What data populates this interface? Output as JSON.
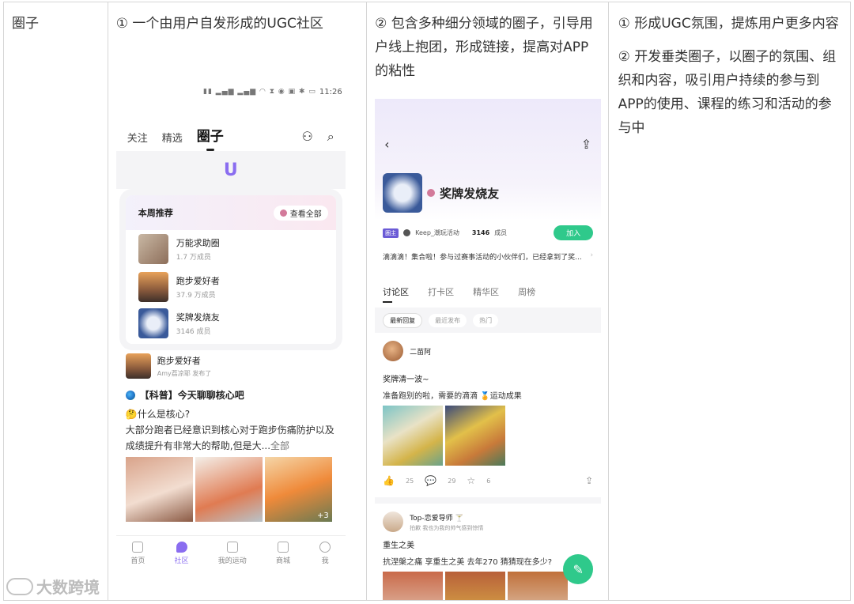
{
  "table": {
    "row_label": "圈子",
    "col2_text": "① 一个由用户自发形成的UGC社区",
    "col3_text": "② 包含多种细分领域的圈子，引导用户线上抱团，形成链接，提高对APP的粘性",
    "col4_p1": "① 形成UGC氛围，提炼用户更多内容",
    "col4_p2": "② 开发垂类圈子，以圈子的氛围、组织和内容，吸引用户持续的参与到APP的使用、课程的练习和活动的参与中"
  },
  "phone1": {
    "status_time": "11:26",
    "tabs": [
      "关注",
      "精选",
      "圈子"
    ],
    "banner_logo": "U",
    "weekly_title": "本周推荐",
    "view_all": "查看全部",
    "circles": [
      {
        "name": "万能求助圈",
        "count": "1.7 万成员"
      },
      {
        "name": "跑步爱好者",
        "count": "37.9 万成员"
      },
      {
        "name": "奖牌发烧友",
        "count": "3146 成员"
      }
    ],
    "post": {
      "circle": "跑步爱好者",
      "sub": "Amy荔凉耶 发布了",
      "title": "【科普】今天聊聊核心吧",
      "line1": "🤔什么是核心?",
      "line2": "大部分跑者已经意识到核心对于跑步伤痛防护以及成绩提升有非常大的帮助,但是大...",
      "more": "全部",
      "extra_count": "+3"
    },
    "tabbar": [
      "首页",
      "社区",
      "我的运动",
      "商城",
      "我"
    ]
  },
  "phone2": {
    "circle_name": "奖牌发烧友",
    "owner_badge": "圈主",
    "owner_name": "Keep_潮玩活动",
    "member_count": "3146",
    "member_unit": "成员",
    "join": "加入",
    "announcement": "滴滴滴！集合啦！参与过赛事活动的小伙伴们，已经拿到了奖...",
    "tabs": [
      "讨论区",
      "打卡区",
      "精华区",
      "周榜"
    ],
    "sorts": [
      "最新回复",
      "最近发布",
      "热门"
    ],
    "post1": {
      "user": "二苗阿",
      "title": "奖牌清一波~",
      "body": "准备跑别的啦，需要的滴滴 🏅运动成果",
      "likes": "25",
      "comments": "29",
      "stars": "6"
    },
    "post2": {
      "user": "Top-恋爱导师 🍸",
      "sub": "拍歉 我也为我的帅气感到惊情",
      "title": "重生之美",
      "body": "抗涅槃之痛 享重生之美 去年270 猜猜现在多少?"
    }
  },
  "watermark": "大数跨境",
  "colors": {
    "accent_purple": "#8a6df0",
    "accent_green": "#2fc98b",
    "border": "#d6d6d6"
  }
}
